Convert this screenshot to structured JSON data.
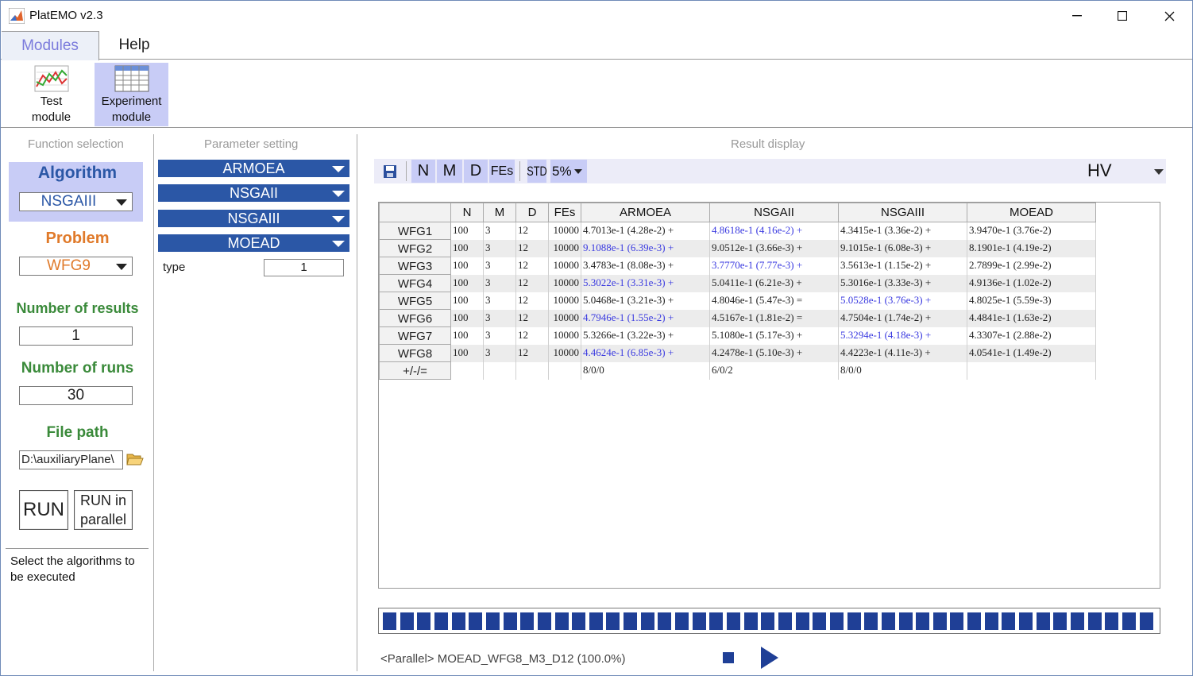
{
  "window": {
    "title": "PlatEMO v2.3",
    "minimize": "—",
    "maximize": "☐",
    "close": "✕"
  },
  "tabs": [
    {
      "label": "Modules"
    },
    {
      "label": "Help"
    }
  ],
  "ribbon": {
    "test_module": "Test\nmodule",
    "experiment_module": "Experiment\nmodule"
  },
  "function_selection": {
    "title": "Function selection",
    "algorithm_label": "Algorithm",
    "algorithm_value": "NSGAIII",
    "problem_label": "Problem",
    "problem_value": "WFG9",
    "results_label": "Number of results",
    "results_value": "1",
    "runs_label": "Number of runs",
    "runs_value": "30",
    "filepath_label": "File path",
    "filepath_value": "D:\\auxiliaryPlane\\",
    "run_button": "RUN",
    "run_parallel_button": "RUN in\nparallel",
    "hint": "Select the algorithms to be executed",
    "colors": {
      "algorithm": "#2b57a6",
      "problem": "#e07a2a",
      "green": "#3a8a3a"
    }
  },
  "parameter_setting": {
    "title": "Parameter setting",
    "algorithms": [
      "ARMOEA",
      "NSGAII",
      "NSGAIII",
      "MOEAD"
    ],
    "param_name": "type",
    "param_value": "1"
  },
  "result_display": {
    "title": "Result display",
    "toolbar": {
      "save_icon": "save-icon",
      "n": "N",
      "m": "M",
      "d": "D",
      "fes": "FEs",
      "std": "STD",
      "sig": "5%",
      "metric": "HV"
    },
    "columns": [
      "N",
      "M",
      "D",
      "FEs",
      "ARMOEA",
      "NSGAII",
      "NSGAIII",
      "MOEAD"
    ],
    "rows": [
      {
        "name": "WFG1",
        "N": "100",
        "M": "3",
        "D": "12",
        "FEs": "10000",
        "vals": [
          "4.7013e-1 (4.28e-2) +",
          "4.8618e-1 (4.16e-2) +",
          "4.3415e-1 (3.36e-2) +",
          "3.9470e-1 (3.76e-2)"
        ],
        "best": 1
      },
      {
        "name": "WFG2",
        "N": "100",
        "M": "3",
        "D": "12",
        "FEs": "10000",
        "vals": [
          "9.1088e-1 (6.39e-3) +",
          "9.0512e-1 (3.66e-3) +",
          "9.1015e-1 (6.08e-3) +",
          "8.1901e-1 (4.19e-2)"
        ],
        "best": 0
      },
      {
        "name": "WFG3",
        "N": "100",
        "M": "3",
        "D": "12",
        "FEs": "10000",
        "vals": [
          "3.4783e-1 (8.08e-3) +",
          "3.7770e-1 (7.77e-3) +",
          "3.5613e-1 (1.15e-2) +",
          "2.7899e-1 (2.99e-2)"
        ],
        "best": 1
      },
      {
        "name": "WFG4",
        "N": "100",
        "M": "3",
        "D": "12",
        "FEs": "10000",
        "vals": [
          "5.3022e-1 (3.31e-3) +",
          "5.0411e-1 (6.21e-3) +",
          "5.3016e-1 (3.33e-3) +",
          "4.9136e-1 (1.02e-2)"
        ],
        "best": 0
      },
      {
        "name": "WFG5",
        "N": "100",
        "M": "3",
        "D": "12",
        "FEs": "10000",
        "vals": [
          "5.0468e-1 (3.21e-3) +",
          "4.8046e-1 (5.47e-3) =",
          "5.0528e-1 (3.76e-3) +",
          "4.8025e-1 (5.59e-3)"
        ],
        "best": 2
      },
      {
        "name": "WFG6",
        "N": "100",
        "M": "3",
        "D": "12",
        "FEs": "10000",
        "vals": [
          "4.7946e-1 (1.55e-2) +",
          "4.5167e-1 (1.81e-2) =",
          "4.7504e-1 (1.74e-2) +",
          "4.4841e-1 (1.63e-2)"
        ],
        "best": 0
      },
      {
        "name": "WFG7",
        "N": "100",
        "M": "3",
        "D": "12",
        "FEs": "10000",
        "vals": [
          "5.3266e-1 (3.22e-3) +",
          "5.1080e-1 (5.17e-3) +",
          "5.3294e-1 (4.18e-3) +",
          "4.3307e-1 (2.88e-2)"
        ],
        "best": 2
      },
      {
        "name": "WFG8",
        "N": "100",
        "M": "3",
        "D": "12",
        "FEs": "10000",
        "vals": [
          "4.4624e-1 (6.85e-3) +",
          "4.2478e-1 (5.10e-3) +",
          "4.4223e-1 (4.11e-3) +",
          "4.0541e-1 (1.49e-2)"
        ],
        "best": 0
      }
    ],
    "summary": {
      "name": "+/-/=",
      "vals": [
        "8/0/0",
        "6/0/2",
        "8/0/0",
        ""
      ]
    },
    "progress": {
      "fraction": 1.0,
      "blocks": 45
    },
    "status": "<Parallel> MOEAD_WFG8_M3_D12 (100.0%)"
  }
}
